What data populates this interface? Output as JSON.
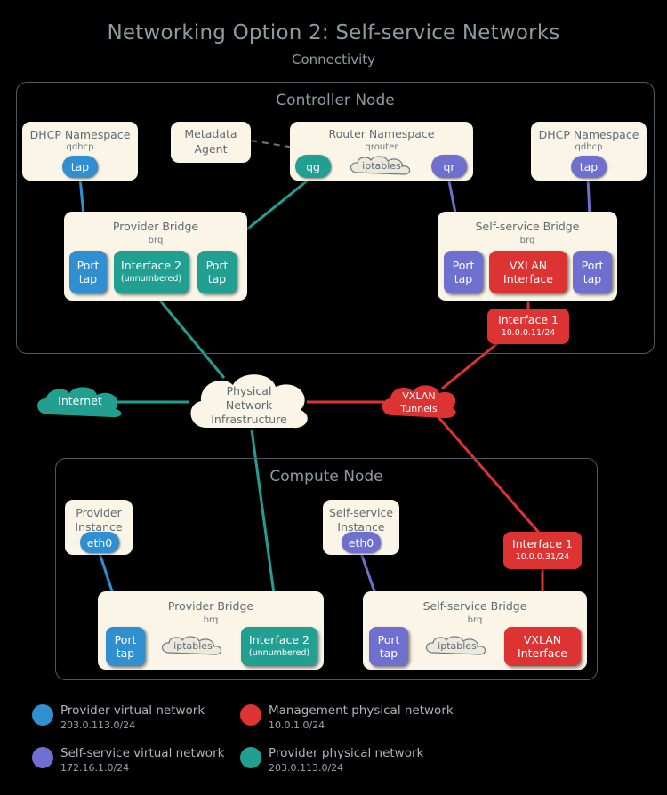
{
  "title": "Networking Option 2: Self-service Networks",
  "subtitle": "Connectivity",
  "colors": {
    "provider_virtual": "#2f8fd0",
    "selfservice_virtual": "#6f6fd0",
    "management_physical": "#dd3333",
    "provider_physical": "#21a092",
    "panel_bg": "#faf5e6",
    "node_border": "#4a5a60",
    "text": "#5d6b73"
  },
  "controller": {
    "title": "Controller Node",
    "dhcp_left": {
      "title": "DHCP Namespace",
      "sub": "qdhcp",
      "pill": "tap"
    },
    "metadata_agent": {
      "line1": "Metadata",
      "line2": "Agent"
    },
    "router": {
      "title": "Router Namespace",
      "sub": "qrouter",
      "qg": "qg",
      "iptables": "iptables",
      "qr": "qr"
    },
    "dhcp_right": {
      "title": "DHCP Namespace",
      "sub": "qdhcp",
      "pill": "tap"
    },
    "provider_bridge": {
      "title": "Provider Bridge",
      "sub": "brq",
      "port_left": {
        "l1": "Port",
        "l2": "tap"
      },
      "interface": {
        "l1": "Interface 2",
        "l2": "(unnumbered)"
      },
      "port_right": {
        "l1": "Port",
        "l2": "tap"
      }
    },
    "selfservice_bridge": {
      "title": "Self-service Bridge",
      "sub": "brq",
      "port_left": {
        "l1": "Port",
        "l2": "tap"
      },
      "vxlan": {
        "l1": "VXLAN",
        "l2": "Interface"
      },
      "port_right": {
        "l1": "Port",
        "l2": "tap"
      }
    },
    "interface1": {
      "l1": "Interface 1",
      "l2": "10.0.0.11/24"
    }
  },
  "middle": {
    "internet": "Internet",
    "physical_network": {
      "l1": "Physical",
      "l2": "Network",
      "l3": "Infrastructure"
    },
    "vxlan_tunnels": {
      "l1": "VXLAN",
      "l2": "Tunnels"
    }
  },
  "compute": {
    "title": "Compute Node",
    "provider_instance": {
      "l1": "Provider",
      "l2": "Instance",
      "pill": "eth0"
    },
    "selfservice_instance": {
      "l1": "Self-service",
      "l2": "Instance",
      "pill": "eth0"
    },
    "interface1": {
      "l1": "Interface 1",
      "l2": "10.0.0.31/24"
    },
    "provider_bridge": {
      "title": "Provider Bridge",
      "sub": "brq",
      "port": {
        "l1": "Port",
        "l2": "tap"
      },
      "iptables": "iptables",
      "interface": {
        "l1": "Interface 2",
        "l2": "(unnumbered)"
      }
    },
    "selfservice_bridge": {
      "title": "Self-service Bridge",
      "sub": "brq",
      "port": {
        "l1": "Port",
        "l2": "tap"
      },
      "iptables": "iptables",
      "vxlan": {
        "l1": "VXLAN",
        "l2": "Interface"
      }
    }
  },
  "legend": [
    {
      "label": "Provider virtual network",
      "cidr": "203.0.113.0/24",
      "color": "#2f8fd0"
    },
    {
      "label": "Management physical network",
      "cidr": "10.0.1.0/24",
      "color": "#dd3333"
    },
    {
      "label": "Self-service virtual network",
      "cidr": "172.16.1.0/24",
      "color": "#6f6fd0"
    },
    {
      "label": "Provider physical network",
      "cidr": "203.0.113.0/24",
      "color": "#21a092"
    }
  ]
}
